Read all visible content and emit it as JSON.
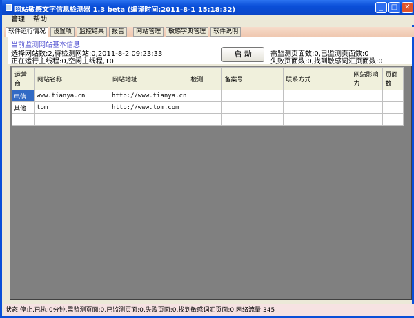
{
  "window": {
    "title": "网站敏感文字信息检测器 1.3 beta (编译时间:2011-8-1 15:18:32)"
  },
  "menu": [
    "管理",
    "帮助"
  ],
  "tabs": [
    "软件运行情况",
    "设置项",
    "监控结果",
    "报告",
    "网站管理",
    "敏感字典管理",
    "软件说明"
  ],
  "info": {
    "header": "当前监测网站基本信息",
    "line1": "选择网站数:2,待检测网站:0,2011-8-2 09:23:33",
    "line2": "正在运行主线程:0,空闲主线程,10",
    "start_button": "启 动",
    "right1": "需监测页面数:0,已监测页面数:0",
    "right2": "失败页面数:0,找到敏感词汇页面数:0"
  },
  "table": {
    "columns": [
      "运营商",
      "网站名称",
      "网站地址",
      "检测",
      "备案号",
      "联系方式",
      "网站影响力",
      "页面数"
    ],
    "rows": [
      [
        "电信",
        "www.tianya.cn",
        "http://www.tianya.cn",
        "",
        "",
        "",
        "",
        ""
      ],
      [
        "其他",
        "tom",
        "http://www.tom.com",
        "",
        "",
        "",
        "",
        ""
      ],
      [
        "",
        "",
        "",
        "",
        "",
        "",
        "",
        ""
      ]
    ]
  },
  "status": "状态:停止,已执:0分钟,需监测页面:0,已监测页面:0,失败页面:0,找到敏感词汇页面:0,网络流量:345"
}
